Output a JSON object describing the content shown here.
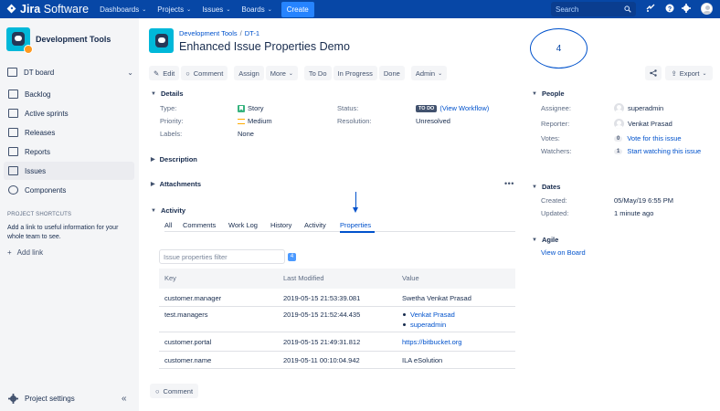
{
  "topnav": {
    "logo_brand": "Jira",
    "logo_product": "Software",
    "items": [
      {
        "label": "Dashboards"
      },
      {
        "label": "Projects"
      },
      {
        "label": "Issues"
      },
      {
        "label": "Boards"
      }
    ],
    "create_label": "Create",
    "search_placeholder": "Search",
    "colors": {
      "nav_bg": "#0747A6",
      "create_bg": "#2684FF"
    }
  },
  "sidebar": {
    "project_name": "Development Tools",
    "board_label": "DT board",
    "items": [
      {
        "label": "Backlog",
        "icon": "backlog-icon"
      },
      {
        "label": "Active sprints",
        "icon": "active-sprints-icon"
      },
      {
        "label": "Releases",
        "icon": "releases-icon"
      },
      {
        "label": "Reports",
        "icon": "reports-icon"
      },
      {
        "label": "Issues",
        "icon": "issues-icon",
        "active": true
      },
      {
        "label": "Components",
        "icon": "components-icon"
      }
    ],
    "shortcuts_title": "PROJECT SHORTCUTS",
    "shortcuts_text": "Add a link to useful information for your whole team to see.",
    "add_link_label": "Add link",
    "project_settings_label": "Project settings"
  },
  "issue": {
    "breadcrumb_project": "Development Tools",
    "breadcrumb_sep": "/",
    "breadcrumb_key": "DT-1",
    "title": "Enhanced Issue Properties Demo"
  },
  "annotation": {
    "circle_number": "4"
  },
  "toolbar": {
    "edit": "Edit",
    "comment": "Comment",
    "assign": "Assign",
    "more": "More",
    "todo": "To Do",
    "in_progress": "In Progress",
    "done": "Done",
    "admin": "Admin",
    "export": "Export"
  },
  "details": {
    "title": "Details",
    "type_label": "Type:",
    "type_value": "Story",
    "priority_label": "Priority:",
    "priority_value": "Medium",
    "labels_label": "Labels:",
    "labels_value": "None",
    "status_label": "Status:",
    "status_lozenge": "TO DO",
    "status_link": "(View Workflow)",
    "resolution_label": "Resolution:",
    "resolution_value": "Unresolved"
  },
  "description_title": "Description",
  "attachments_title": "Attachments",
  "activity": {
    "title": "Activity",
    "tabs": [
      "All",
      "Comments",
      "Work Log",
      "History",
      "Activity",
      "Properties"
    ],
    "active_tab": "Properties",
    "filter_placeholder": "Issue properties filter",
    "count": "4",
    "columns": [
      "Key",
      "Last Modified",
      "Value"
    ],
    "rows": [
      {
        "key": "customer.manager",
        "modified": "2019-05-15 21:53:39.081",
        "value": "Swetha Venkat Prasad"
      },
      {
        "key": "test.managers",
        "modified": "2019-05-15 21:52:44.435",
        "value_list": [
          "Venkat Prasad",
          "superadmin"
        ]
      },
      {
        "key": "customer.portal",
        "modified": "2019-05-15 21:49:31.812",
        "value": "https://bitbucket.org"
      },
      {
        "key": "customer.name",
        "modified": "2019-05-11 00:10:04.942",
        "value": "ILA eSolution"
      }
    ],
    "comment_button": "Comment"
  },
  "people": {
    "title": "People",
    "assignee_label": "Assignee:",
    "assignee_value": "superadmin",
    "reporter_label": "Reporter:",
    "reporter_value": "Venkat Prasad",
    "votes_label": "Votes:",
    "votes_count": "0",
    "votes_link": "Vote for this issue",
    "watchers_label": "Watchers:",
    "watchers_count": "1",
    "watchers_link": "Start watching this issue"
  },
  "dates": {
    "title": "Dates",
    "created_label": "Created:",
    "created_value": "05/May/19 6:55 PM",
    "updated_label": "Updated:",
    "updated_value": "1 minute ago"
  },
  "agile": {
    "title": "Agile",
    "link": "View on Board"
  }
}
